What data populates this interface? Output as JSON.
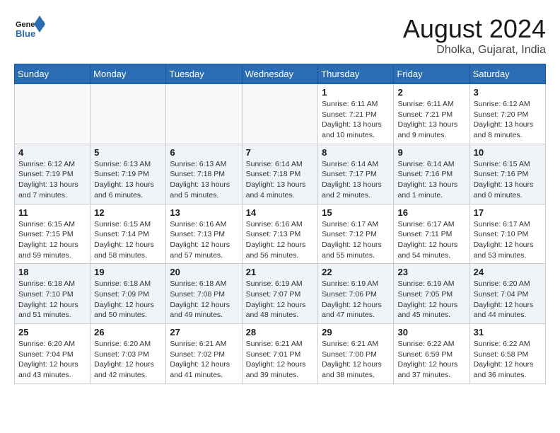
{
  "header": {
    "logo_line1": "General",
    "logo_line2": "Blue",
    "month": "August 2024",
    "location": "Dholka, Gujarat, India"
  },
  "weekdays": [
    "Sunday",
    "Monday",
    "Tuesday",
    "Wednesday",
    "Thursday",
    "Friday",
    "Saturday"
  ],
  "weeks": [
    [
      {
        "day": "",
        "info": ""
      },
      {
        "day": "",
        "info": ""
      },
      {
        "day": "",
        "info": ""
      },
      {
        "day": "",
        "info": ""
      },
      {
        "day": "1",
        "info": "Sunrise: 6:11 AM\nSunset: 7:21 PM\nDaylight: 13 hours and 10 minutes."
      },
      {
        "day": "2",
        "info": "Sunrise: 6:11 AM\nSunset: 7:21 PM\nDaylight: 13 hours and 9 minutes."
      },
      {
        "day": "3",
        "info": "Sunrise: 6:12 AM\nSunset: 7:20 PM\nDaylight: 13 hours and 8 minutes."
      }
    ],
    [
      {
        "day": "4",
        "info": "Sunrise: 6:12 AM\nSunset: 7:19 PM\nDaylight: 13 hours and 7 minutes."
      },
      {
        "day": "5",
        "info": "Sunrise: 6:13 AM\nSunset: 7:19 PM\nDaylight: 13 hours and 6 minutes."
      },
      {
        "day": "6",
        "info": "Sunrise: 6:13 AM\nSunset: 7:18 PM\nDaylight: 13 hours and 5 minutes."
      },
      {
        "day": "7",
        "info": "Sunrise: 6:14 AM\nSunset: 7:18 PM\nDaylight: 13 hours and 4 minutes."
      },
      {
        "day": "8",
        "info": "Sunrise: 6:14 AM\nSunset: 7:17 PM\nDaylight: 13 hours and 2 minutes."
      },
      {
        "day": "9",
        "info": "Sunrise: 6:14 AM\nSunset: 7:16 PM\nDaylight: 13 hours and 1 minute."
      },
      {
        "day": "10",
        "info": "Sunrise: 6:15 AM\nSunset: 7:16 PM\nDaylight: 13 hours and 0 minutes."
      }
    ],
    [
      {
        "day": "11",
        "info": "Sunrise: 6:15 AM\nSunset: 7:15 PM\nDaylight: 12 hours and 59 minutes."
      },
      {
        "day": "12",
        "info": "Sunrise: 6:15 AM\nSunset: 7:14 PM\nDaylight: 12 hours and 58 minutes."
      },
      {
        "day": "13",
        "info": "Sunrise: 6:16 AM\nSunset: 7:13 PM\nDaylight: 12 hours and 57 minutes."
      },
      {
        "day": "14",
        "info": "Sunrise: 6:16 AM\nSunset: 7:13 PM\nDaylight: 12 hours and 56 minutes."
      },
      {
        "day": "15",
        "info": "Sunrise: 6:17 AM\nSunset: 7:12 PM\nDaylight: 12 hours and 55 minutes."
      },
      {
        "day": "16",
        "info": "Sunrise: 6:17 AM\nSunset: 7:11 PM\nDaylight: 12 hours and 54 minutes."
      },
      {
        "day": "17",
        "info": "Sunrise: 6:17 AM\nSunset: 7:10 PM\nDaylight: 12 hours and 53 minutes."
      }
    ],
    [
      {
        "day": "18",
        "info": "Sunrise: 6:18 AM\nSunset: 7:10 PM\nDaylight: 12 hours and 51 minutes."
      },
      {
        "day": "19",
        "info": "Sunrise: 6:18 AM\nSunset: 7:09 PM\nDaylight: 12 hours and 50 minutes."
      },
      {
        "day": "20",
        "info": "Sunrise: 6:18 AM\nSunset: 7:08 PM\nDaylight: 12 hours and 49 minutes."
      },
      {
        "day": "21",
        "info": "Sunrise: 6:19 AM\nSunset: 7:07 PM\nDaylight: 12 hours and 48 minutes."
      },
      {
        "day": "22",
        "info": "Sunrise: 6:19 AM\nSunset: 7:06 PM\nDaylight: 12 hours and 47 minutes."
      },
      {
        "day": "23",
        "info": "Sunrise: 6:19 AM\nSunset: 7:05 PM\nDaylight: 12 hours and 45 minutes."
      },
      {
        "day": "24",
        "info": "Sunrise: 6:20 AM\nSunset: 7:04 PM\nDaylight: 12 hours and 44 minutes."
      }
    ],
    [
      {
        "day": "25",
        "info": "Sunrise: 6:20 AM\nSunset: 7:04 PM\nDaylight: 12 hours and 43 minutes."
      },
      {
        "day": "26",
        "info": "Sunrise: 6:20 AM\nSunset: 7:03 PM\nDaylight: 12 hours and 42 minutes."
      },
      {
        "day": "27",
        "info": "Sunrise: 6:21 AM\nSunset: 7:02 PM\nDaylight: 12 hours and 41 minutes."
      },
      {
        "day": "28",
        "info": "Sunrise: 6:21 AM\nSunset: 7:01 PM\nDaylight: 12 hours and 39 minutes."
      },
      {
        "day": "29",
        "info": "Sunrise: 6:21 AM\nSunset: 7:00 PM\nDaylight: 12 hours and 38 minutes."
      },
      {
        "day": "30",
        "info": "Sunrise: 6:22 AM\nSunset: 6:59 PM\nDaylight: 12 hours and 37 minutes."
      },
      {
        "day": "31",
        "info": "Sunrise: 6:22 AM\nSunset: 6:58 PM\nDaylight: 12 hours and 36 minutes."
      }
    ]
  ]
}
